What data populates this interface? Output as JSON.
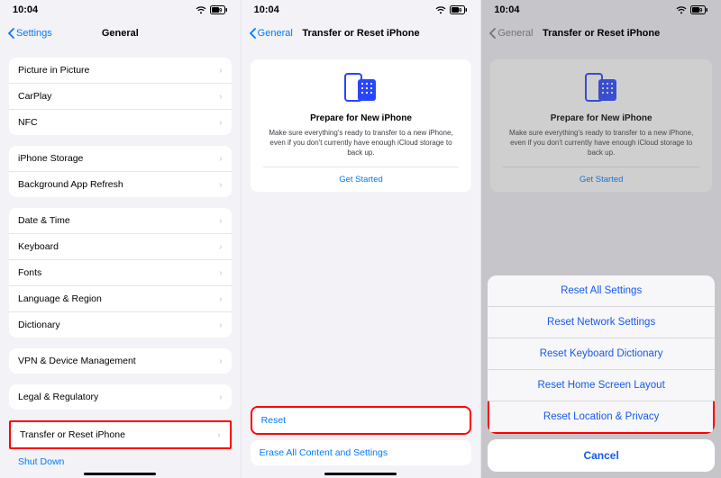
{
  "status": {
    "time": "10:04",
    "battery": "59"
  },
  "screen1": {
    "back": "Settings",
    "title": "General",
    "group1": [
      "Picture in Picture",
      "CarPlay",
      "NFC"
    ],
    "group2": [
      "iPhone Storage",
      "Background App Refresh"
    ],
    "group3": [
      "Date & Time",
      "Keyboard",
      "Fonts",
      "Language & Region",
      "Dictionary"
    ],
    "group4": [
      "VPN & Device Management"
    ],
    "group5": [
      "Legal & Regulatory"
    ],
    "group6": [
      "Transfer or Reset iPhone"
    ],
    "shutdown": "Shut Down"
  },
  "screen2": {
    "back": "General",
    "title": "Transfer or Reset iPhone",
    "card": {
      "heading": "Prepare for New iPhone",
      "body": "Make sure everything's ready to transfer to a new iPhone, even if you don't currently have enough iCloud storage to back up.",
      "cta": "Get Started"
    },
    "reset": "Reset",
    "erase": "Erase All Content and Settings"
  },
  "screen3": {
    "back": "General",
    "title": "Transfer or Reset iPhone",
    "card": {
      "heading": "Prepare for New iPhone",
      "body": "Make sure everything's ready to transfer to a new iPhone, even if you don't currently have enough iCloud storage to back up.",
      "cta": "Get Started"
    },
    "sheet": {
      "options": [
        "Reset All Settings",
        "Reset Network Settings",
        "Reset Keyboard Dictionary",
        "Reset Home Screen Layout",
        "Reset Location & Privacy"
      ],
      "cancel": "Cancel"
    }
  }
}
